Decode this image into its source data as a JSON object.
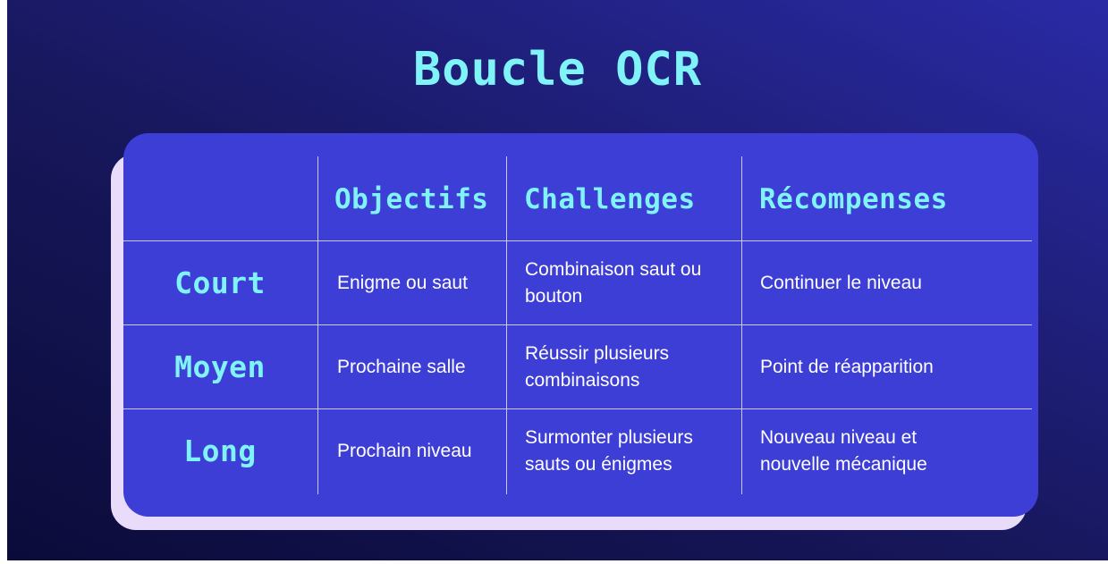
{
  "title": "Boucle OCR",
  "table": {
    "columns": [
      "Objectifs",
      "Challenges",
      "Récompenses"
    ],
    "rows": [
      {
        "label": "Court",
        "objectif": "Enigme ou saut",
        "challenge": "Combinaison saut ou bouton",
        "recompense": "Continuer le niveau"
      },
      {
        "label": "Moyen",
        "objectif": "Prochaine salle",
        "challenge": "Réussir plusieurs combinaisons",
        "recompense": "Point de réapparition"
      },
      {
        "label": "Long",
        "objectif": "Prochain niveau",
        "challenge": "Surmonter plusieurs sauts ou énigmes",
        "recompense": "Nouveau niveau et nouvelle mécanique"
      }
    ]
  },
  "colors": {
    "background_dark": "#0b0b3a",
    "background_light": "#2a2aa6",
    "card": "#3d3ed6",
    "card_shadow": "#e9dcfb",
    "accent": "#7ff3f7",
    "body_text": "#ffffff"
  }
}
